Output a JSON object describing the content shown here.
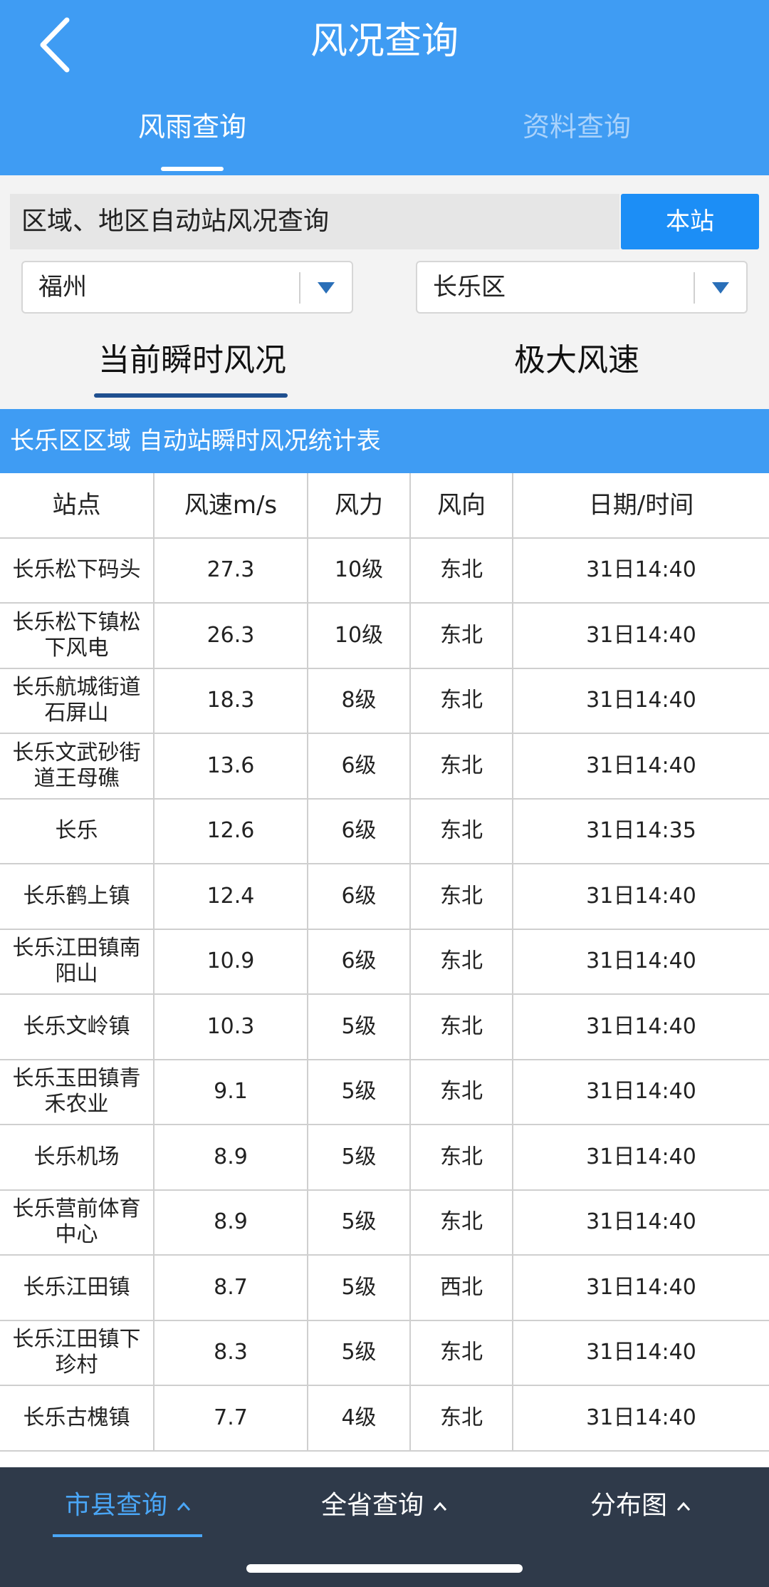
{
  "header": {
    "title": "风况查询"
  },
  "top_tabs": [
    {
      "label": "风雨查询"
    },
    {
      "label": "资料查询"
    }
  ],
  "search": {
    "label": "区域、地区自动站风况查询",
    "button": "本站"
  },
  "selects": [
    {
      "value": "福州"
    },
    {
      "value": "长乐区"
    }
  ],
  "sub_tabs": [
    {
      "label": "当前瞬时风况"
    },
    {
      "label": "极大风速"
    }
  ],
  "table": {
    "title": "长乐区区域 自动站瞬时风况统计表",
    "headers": [
      "站点",
      "风速m/s",
      "风力",
      "风向",
      "日期/时间"
    ],
    "rows": [
      [
        "长乐松下码头",
        "27.3",
        "10级",
        "东北",
        "31日14:40"
      ],
      [
        "长乐松下镇松下风电",
        "26.3",
        "10级",
        "东北",
        "31日14:40"
      ],
      [
        "长乐航城街道石屏山",
        "18.3",
        "8级",
        "东北",
        "31日14:40"
      ],
      [
        "长乐文武砂街道王母礁",
        "13.6",
        "6级",
        "东北",
        "31日14:40"
      ],
      [
        "长乐",
        "12.6",
        "6级",
        "东北",
        "31日14:35"
      ],
      [
        "长乐鹤上镇",
        "12.4",
        "6级",
        "东北",
        "31日14:40"
      ],
      [
        "长乐江田镇南阳山",
        "10.9",
        "6级",
        "东北",
        "31日14:40"
      ],
      [
        "长乐文岭镇",
        "10.3",
        "5级",
        "东北",
        "31日14:40"
      ],
      [
        "长乐玉田镇青禾农业",
        "9.1",
        "5级",
        "东北",
        "31日14:40"
      ],
      [
        "长乐机场",
        "8.9",
        "5级",
        "东北",
        "31日14:40"
      ],
      [
        "长乐营前体育中心",
        "8.9",
        "5级",
        "东北",
        "31日14:40"
      ],
      [
        "长乐江田镇",
        "8.7",
        "5级",
        "西北",
        "31日14:40"
      ],
      [
        "长乐江田镇下珍村",
        "8.3",
        "5级",
        "东北",
        "31日14:40"
      ],
      [
        "长乐古槐镇",
        "7.7",
        "4级",
        "东北",
        "31日14:40"
      ]
    ]
  },
  "bottom_nav": [
    {
      "label": "市县查询"
    },
    {
      "label": "全省查询"
    },
    {
      "label": "分布图"
    }
  ],
  "colors": {
    "primary": "#3f9cf3",
    "button": "#1c8ef6",
    "nav_bg": "#2f3a4a",
    "nav_active": "#4aa6f6"
  }
}
